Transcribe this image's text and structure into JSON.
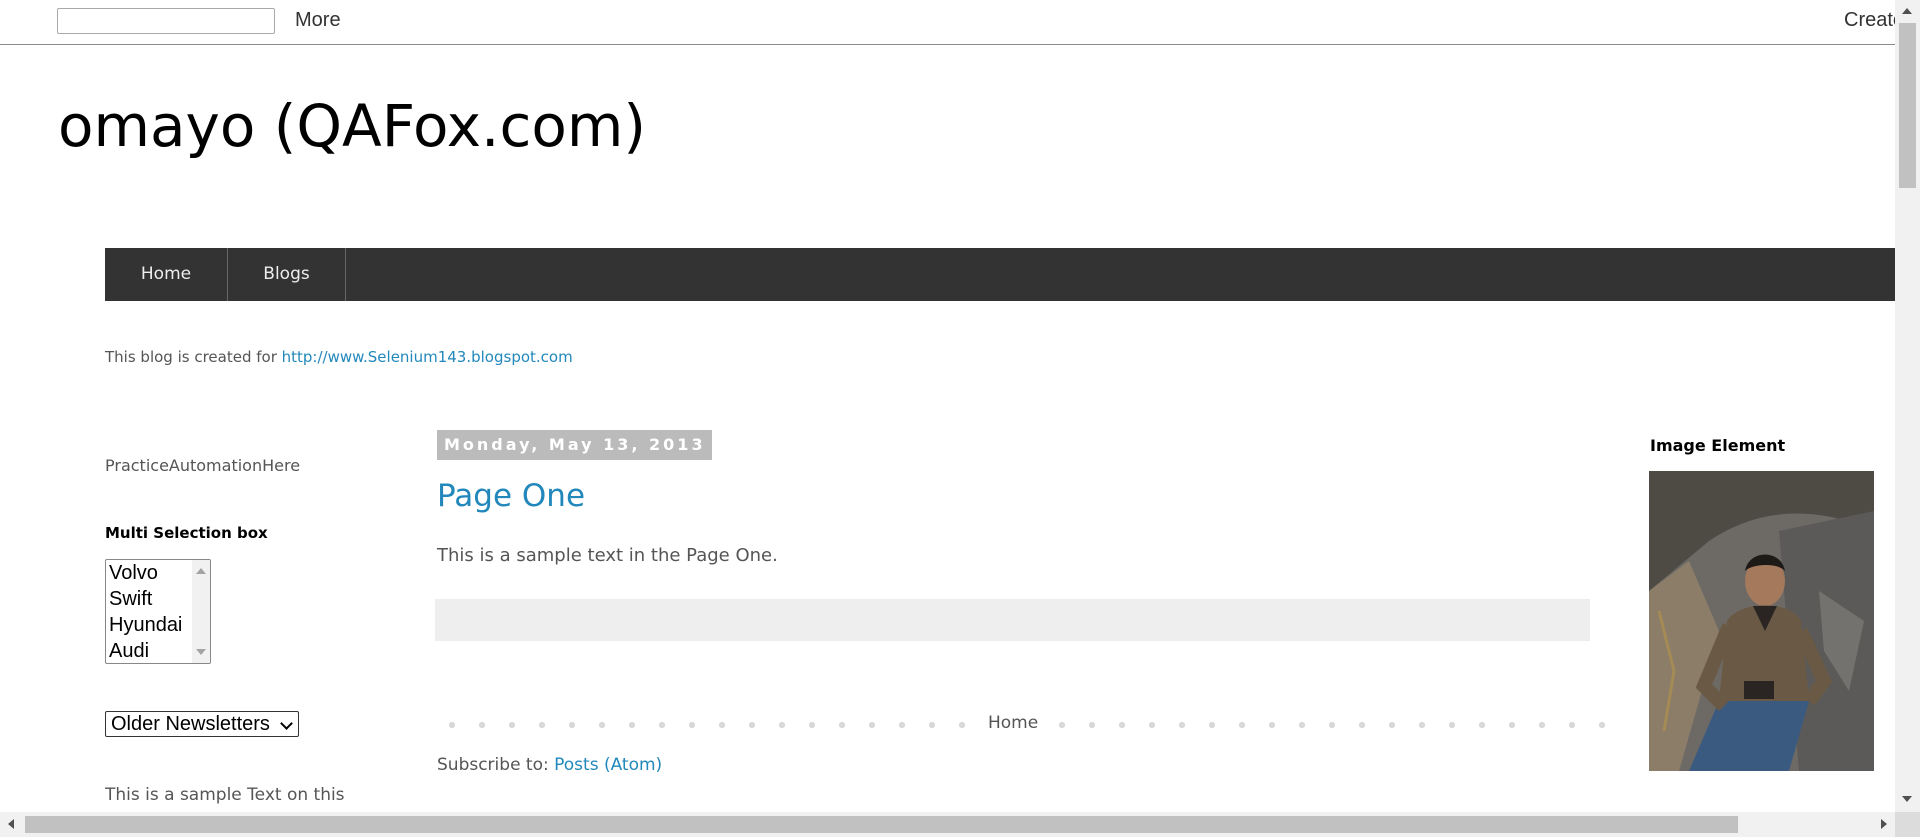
{
  "topbar": {
    "search_value": "",
    "more_label": "More",
    "create_label": "Create"
  },
  "site": {
    "title": "omayo (QAFox.com)"
  },
  "nav": {
    "items": [
      {
        "label": "Home"
      },
      {
        "label": "Blogs"
      }
    ]
  },
  "description": {
    "prefix": "This blog is created for ",
    "link_text": "http://www.Selenium143.blogspot.com"
  },
  "sidebar_left": {
    "text1": "PracticeAutomationHere",
    "multi_heading": "Multi Selection box",
    "multi_options": [
      "Volvo",
      "Swift",
      "Hyundai",
      "Audi"
    ],
    "newsletter_selected": "Older Newsletters",
    "text2": "This is a sample Text on this"
  },
  "post": {
    "date": "Monday, May 13, 2013",
    "title": "Page One",
    "body": "This is a sample text in the Page One."
  },
  "pager": {
    "home_label": "Home"
  },
  "subscribe": {
    "prefix": "Subscribe to: ",
    "link_text": "Posts (Atom)"
  },
  "sidebar_right": {
    "image_heading": "Image Element"
  }
}
